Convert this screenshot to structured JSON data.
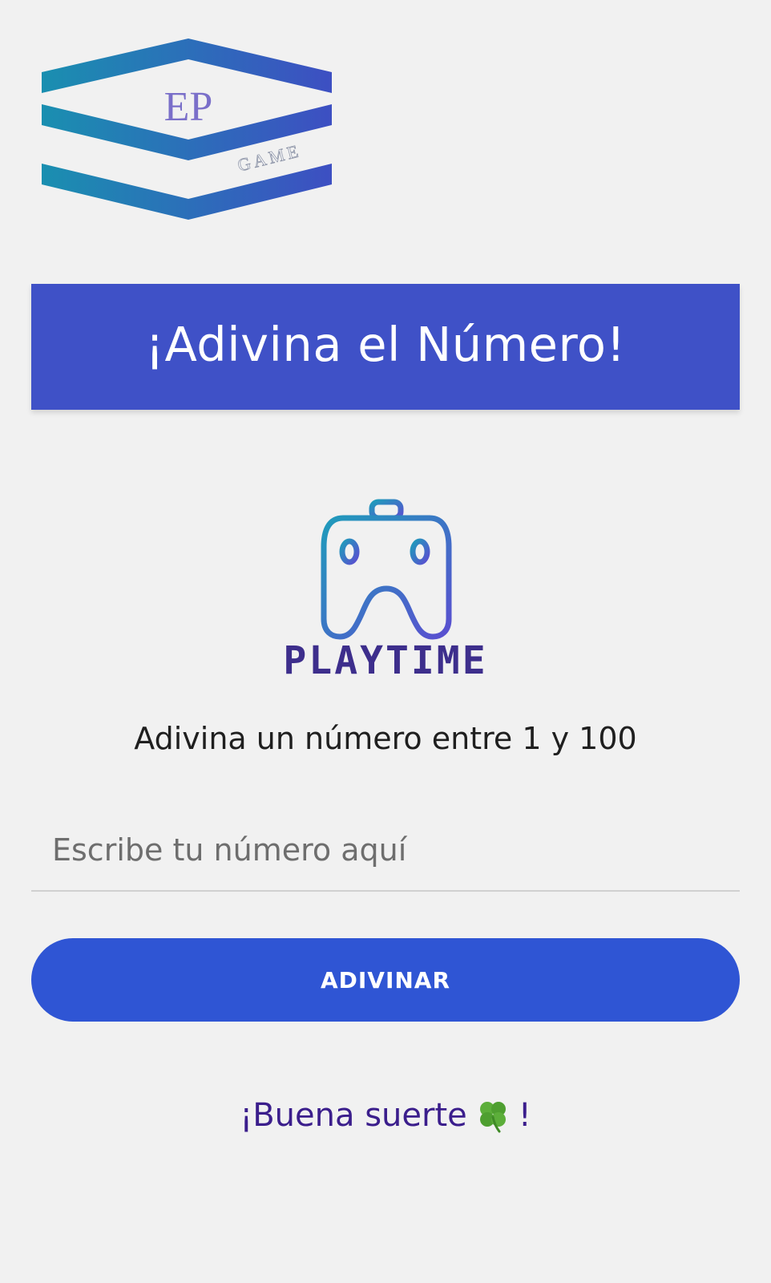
{
  "logo": {
    "letters": "EP",
    "subtitle": "GAME"
  },
  "header": {
    "title": "¡Adivina el Número!"
  },
  "brand": {
    "name": "PLAYTIME"
  },
  "game": {
    "instruction": "Adivina un número entre 1 y 100",
    "input_placeholder": "Escribe tu número aquí",
    "input_value": "",
    "button_label": "ADIVINAR"
  },
  "footer": {
    "luck_start": "¡Buena suerte",
    "luck_end": "!",
    "luck_icon": "four-leaf-clover-icon"
  },
  "colors": {
    "header_bg": "#3f51c7",
    "button_bg": "#2f55d4",
    "brand_text": "#3d2e8c",
    "luck_text": "#3b1e8c",
    "background": "#f1f1f1"
  }
}
